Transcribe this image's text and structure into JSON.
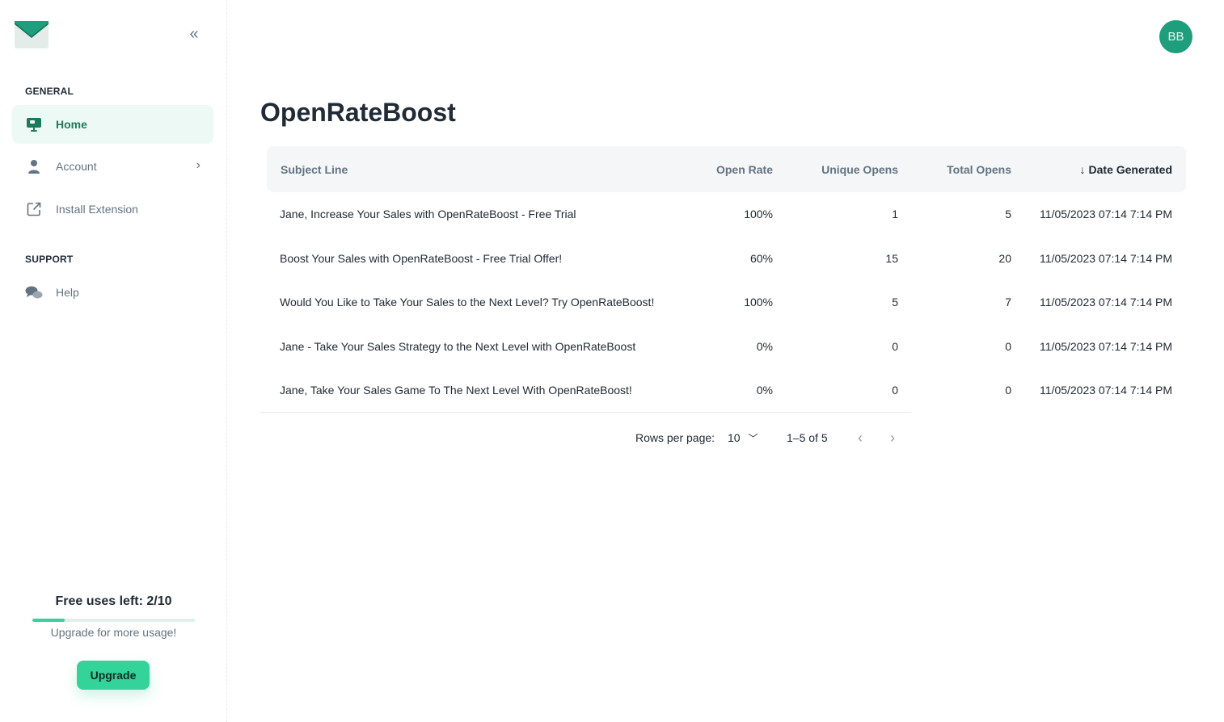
{
  "sidebar": {
    "logo": "envelope-logo",
    "sections": [
      {
        "title": "GENERAL"
      },
      {
        "title": "SUPPORT"
      }
    ],
    "items": [
      {
        "label": "Home",
        "icon": "monitor-icon",
        "active": true
      },
      {
        "label": "Account",
        "icon": "person-icon"
      },
      {
        "label": "Install Extension",
        "icon": "external-link-icon"
      },
      {
        "label": "Help",
        "icon": "chat-bubbles-icon"
      }
    ],
    "usage": {
      "title": "Free uses left: 2/10",
      "used_fraction": 0.2,
      "subtitle": "Upgrade for more usage!",
      "button": "Upgrade"
    }
  },
  "header": {
    "avatar_initials": "BB"
  },
  "main": {
    "title": "OpenRateBoost",
    "table": {
      "columns": [
        "Subject Line",
        "Open Rate",
        "Unique Opens",
        "Total Opens",
        "Date Generated"
      ],
      "sorted_column": "Date Generated",
      "sort_direction": "desc",
      "rows": [
        [
          "Jane, Increase Your Sales with OpenRateBoost - Free Trial",
          "100%",
          "1",
          "5",
          "11/05/2023 07:14 7:14 PM"
        ],
        [
          "Boost Your Sales with OpenRateBoost - Free Trial Offer!",
          "60%",
          "15",
          "20",
          "11/05/2023 07:14 7:14 PM"
        ],
        [
          "Would You Like to Take Your Sales to the Next Level? Try OpenRateBoost!",
          "100%",
          "5",
          "7",
          "11/05/2023 07:14 7:14 PM"
        ],
        [
          "Jane - Take Your Sales Strategy to the Next Level with OpenRateBoost",
          "0%",
          "0",
          "0",
          "11/05/2023 07:14 7:14 PM"
        ],
        [
          "Jane, Take Your Sales Game To The Next Level With OpenRateBoost!",
          "0%",
          "0",
          "0",
          "11/05/2023 07:14 7:14 PM"
        ]
      ]
    },
    "pagination": {
      "rows_per_page_label": "Rows per page:",
      "rows_per_page_value": "10",
      "range": "1–5 of 5"
    }
  },
  "colors": {
    "accent": "#34d399",
    "avatar": "#1e9e7c",
    "active_nav_bg": "#edf9f4",
    "active_nav_text": "#1a7a5a"
  }
}
